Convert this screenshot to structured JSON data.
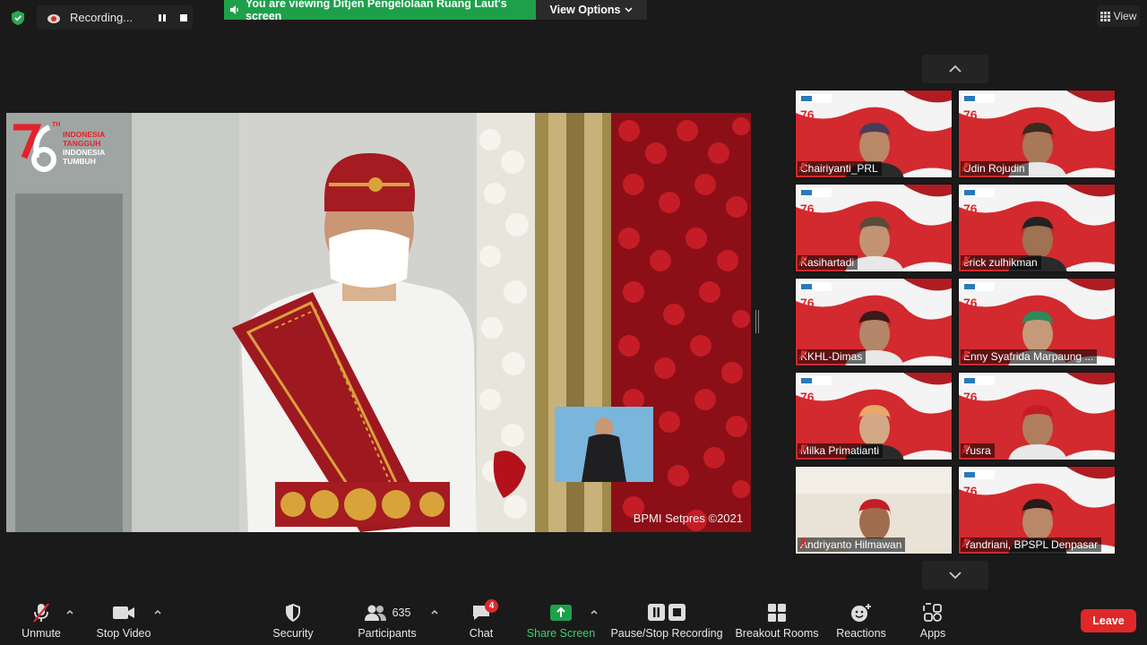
{
  "top_bar": {
    "recording_label": "Recording...",
    "viewing_banner": "You are viewing Ditjen Pengelolaan Ruang Laut's screen",
    "view_options": "View Options",
    "view_label": "View"
  },
  "share": {
    "watermark": "BPMI Setpres ©2021",
    "logo_lines": [
      "INDONESIA",
      "TANGGUH",
      "INDONESIA",
      "TUMBUH"
    ],
    "logo_superscript": "TH"
  },
  "participants": [
    {
      "name": "Chairiyanti_PRL"
    },
    {
      "name": "Udin Rojudin"
    },
    {
      "name": "Kasihartadi"
    },
    {
      "name": "erick zulhikman"
    },
    {
      "name": "KKHL-Dimas"
    },
    {
      "name": "Enny Syafrida Marpaung ..."
    },
    {
      "name": "Milka Primatianti"
    },
    {
      "name": "Yusra"
    },
    {
      "name": "Andriyanto Hilmawan"
    },
    {
      "name": "Yandriani, BPSPL Denpasar"
    }
  ],
  "toolbar": {
    "unmute": "Unmute",
    "stop_video": "Stop Video",
    "security": "Security",
    "participants": "Participants",
    "participants_count": "635",
    "chat": "Chat",
    "chat_badge": "4",
    "share_screen": "Share Screen",
    "pause_stop_recording": "Pause/Stop Recording",
    "breakout_rooms": "Breakout Rooms",
    "reactions": "Reactions",
    "apps": "Apps",
    "leave": "Leave"
  },
  "colors": {
    "share_green": "#1ea04a",
    "leave_red": "#e02828",
    "tile_red": "#d9262b"
  }
}
